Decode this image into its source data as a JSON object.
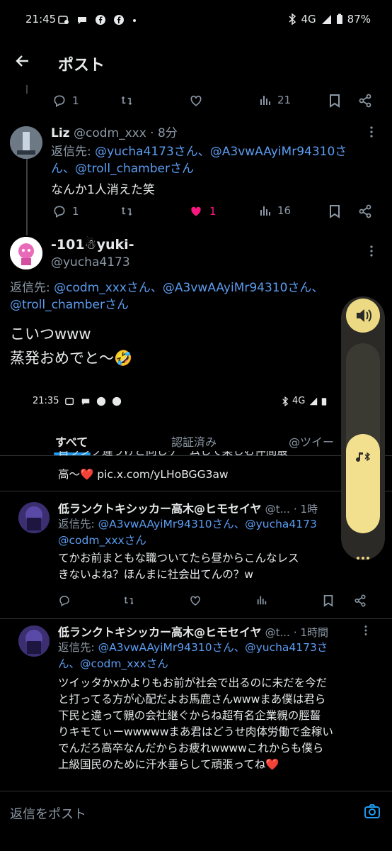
{
  "status_bar": {
    "time": "21:45",
    "network": "4G",
    "battery": "87%"
  },
  "header": {
    "title": "ポスト"
  },
  "prev_actions": {
    "replies": "1",
    "views": "21"
  },
  "reply1": {
    "name": "Liz",
    "handle": "@codm_xxx",
    "time": "· 8分",
    "reply_label": "返信先: ",
    "mentions_line1": "@yucha4173さん、@A3vwAAyiMr94310さ",
    "mentions_line2": "ん、@troll_chamberさん",
    "text": "なんか1人消えた笑",
    "replies": "1",
    "likes": "1",
    "views": "16"
  },
  "main_post": {
    "name": "-101☃yuki-",
    "handle": "@yucha4173",
    "reply_label": "返信先: ",
    "mentions_line1": "@codm_xxxさん、@A3vwAAyiMr94310さん、",
    "mentions_line2": "@troll_chamberさん",
    "text_line1": "こいつwww",
    "text_line2": "蒸発おめでと〜🤣"
  },
  "embedded": {
    "status_time": "21:35",
    "status_network": "4G",
    "tabs": [
      "すべて",
      "認証済み",
      "@ツイー"
    ],
    "partial_text": "高〜❤️ pic.x.com/yLHoBGG3aw",
    "partial_top": "自ランク違うけど同じゲームして楽しむ仲間最",
    "post1": {
      "name": "低ランクトキシッカー高木@ヒモセイヤ",
      "handle": "@t...",
      "time": "· 1時",
      "reply_label": "返信先: ",
      "mentions_line1": "@A3vwAAyiMr94310さん、@yucha4173",
      "mentions_line2": "@codm_xxxさん",
      "text_line1": "てかお前まともな職ついてたら昼からこんなレス",
      "text_line2": "きないよね？ほんまに社会出てんの？w"
    },
    "post2": {
      "name": "低ランクトキシッカー高木@ヒモセイヤ",
      "handle": "@t...",
      "time": "· 1時間",
      "reply_label": "返信先: ",
      "mentions_line1": "@A3vwAAyiMr94310さん、@yucha4173さ",
      "mentions_line2": "ん、@codm_xxxさん",
      "text_lines": [
        "ツイッタかxかよりもお前が社会で出るのに未だを今だ",
        "と打ってる方が心配だよお馬鹿さんwwwまあ僕は君ら",
        "下民と違って親の会社継ぐからね超有名企業親の脛齧",
        "りキモてぃーwwwwwまあ君はどうせ肉体労働で金稼い",
        "でんだろ高卒なんだからお疲れwwwwこれからも僕ら",
        "上級国民のために汗水垂らして頑張ってね❤️"
      ]
    }
  },
  "reply_bar": {
    "placeholder": "返信をポスト"
  },
  "colors": {
    "mention": "#5b9cf0",
    "like_active": "#f91880",
    "volume_accent": "#ecd984"
  }
}
